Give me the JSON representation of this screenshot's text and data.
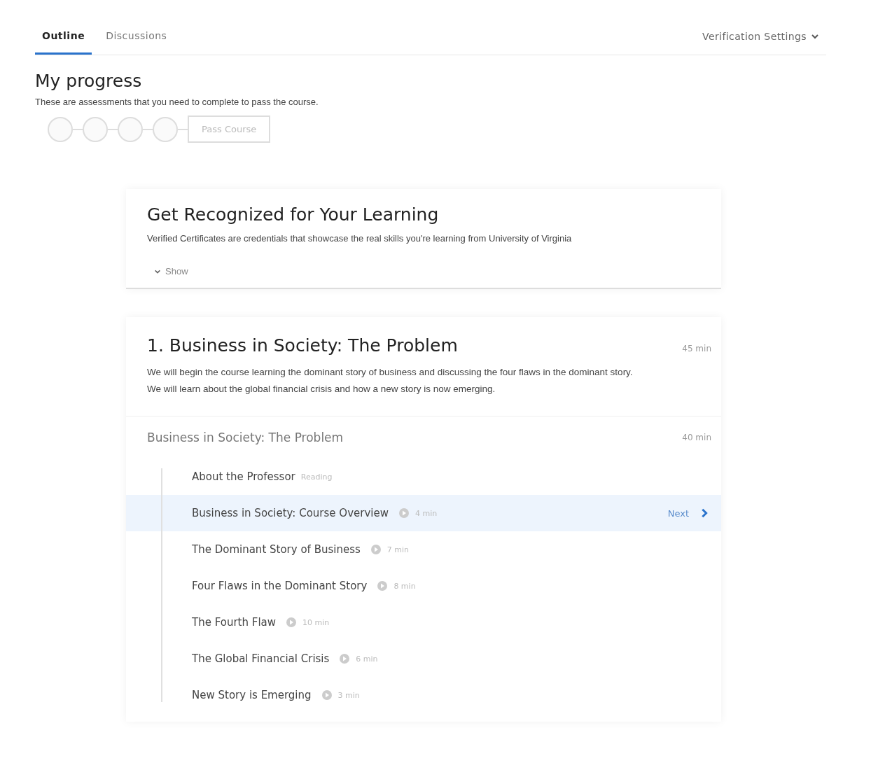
{
  "tabs": [
    {
      "label": "Outline",
      "selected": true
    },
    {
      "label": "Discussions",
      "selected": false
    }
  ],
  "settings_menu": {
    "label": "Verification Settings"
  },
  "progress": {
    "title": "My progress",
    "description": "These are assessments that you need to complete to pass the course.",
    "steps": [
      {
        "done": false
      },
      {
        "done": false
      },
      {
        "done": false
      },
      {
        "done": false
      }
    ],
    "goal": "Pass Course"
  },
  "certificate_card": {
    "title": "Get Recognized for Your Learning",
    "description": "Verified Certificates are credentials that showcase the real skills you're learning from University of Virginia",
    "toggle": {
      "label": "Show",
      "expanded": false
    }
  },
  "week": {
    "title": "1. Business in Society: The Problem",
    "duration": "45 min",
    "description": "We will begin the course learning the dominant story of business and discussing the four flaws in the dominant story. We will learn about the global financial crisis and how a new story is now emerging.",
    "lesson": {
      "title": "Business in Society: The Problem",
      "duration": "40 min",
      "items": [
        {
          "title": "About the Professor",
          "kind": "reading",
          "meta": "Reading",
          "selected": false
        },
        {
          "title": "Business in Society: Course Overview",
          "kind": "video",
          "meta": "4 min",
          "selected": true
        },
        {
          "title": "The Dominant Story of Business",
          "kind": "video",
          "meta": "7 min",
          "selected": false
        },
        {
          "title": "Four Flaws in the Dominant Story",
          "kind": "video",
          "meta": "8 min",
          "selected": false
        },
        {
          "title": "The Fourth Flaw",
          "kind": "video",
          "meta": "10 min",
          "selected": false
        },
        {
          "title": "The Global Financial Crisis",
          "kind": "video",
          "meta": "6 min",
          "selected": false
        },
        {
          "title": "New Story is Emerging",
          "kind": "video",
          "meta": "3 min",
          "selected": false
        }
      ],
      "next_label": "Next"
    }
  }
}
